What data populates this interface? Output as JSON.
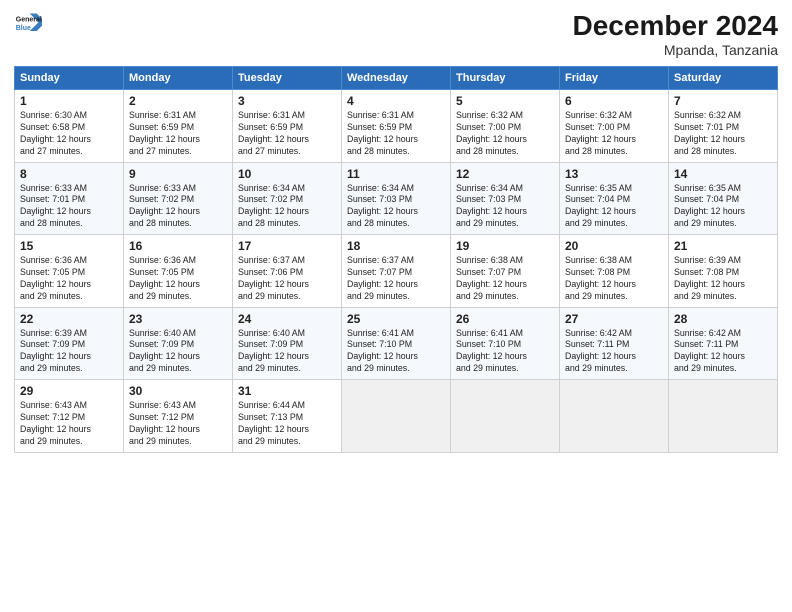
{
  "header": {
    "logo_line1": "General",
    "logo_line2": "Blue",
    "month": "December 2024",
    "location": "Mpanda, Tanzania"
  },
  "weekdays": [
    "Sunday",
    "Monday",
    "Tuesday",
    "Wednesday",
    "Thursday",
    "Friday",
    "Saturday"
  ],
  "weeks": [
    [
      {
        "day": "1",
        "info": "Sunrise: 6:30 AM\nSunset: 6:58 PM\nDaylight: 12 hours\nand 27 minutes."
      },
      {
        "day": "2",
        "info": "Sunrise: 6:31 AM\nSunset: 6:59 PM\nDaylight: 12 hours\nand 27 minutes."
      },
      {
        "day": "3",
        "info": "Sunrise: 6:31 AM\nSunset: 6:59 PM\nDaylight: 12 hours\nand 27 minutes."
      },
      {
        "day": "4",
        "info": "Sunrise: 6:31 AM\nSunset: 6:59 PM\nDaylight: 12 hours\nand 28 minutes."
      },
      {
        "day": "5",
        "info": "Sunrise: 6:32 AM\nSunset: 7:00 PM\nDaylight: 12 hours\nand 28 minutes."
      },
      {
        "day": "6",
        "info": "Sunrise: 6:32 AM\nSunset: 7:00 PM\nDaylight: 12 hours\nand 28 minutes."
      },
      {
        "day": "7",
        "info": "Sunrise: 6:32 AM\nSunset: 7:01 PM\nDaylight: 12 hours\nand 28 minutes."
      }
    ],
    [
      {
        "day": "8",
        "info": "Sunrise: 6:33 AM\nSunset: 7:01 PM\nDaylight: 12 hours\nand 28 minutes."
      },
      {
        "day": "9",
        "info": "Sunrise: 6:33 AM\nSunset: 7:02 PM\nDaylight: 12 hours\nand 28 minutes."
      },
      {
        "day": "10",
        "info": "Sunrise: 6:34 AM\nSunset: 7:02 PM\nDaylight: 12 hours\nand 28 minutes."
      },
      {
        "day": "11",
        "info": "Sunrise: 6:34 AM\nSunset: 7:03 PM\nDaylight: 12 hours\nand 28 minutes."
      },
      {
        "day": "12",
        "info": "Sunrise: 6:34 AM\nSunset: 7:03 PM\nDaylight: 12 hours\nand 29 minutes."
      },
      {
        "day": "13",
        "info": "Sunrise: 6:35 AM\nSunset: 7:04 PM\nDaylight: 12 hours\nand 29 minutes."
      },
      {
        "day": "14",
        "info": "Sunrise: 6:35 AM\nSunset: 7:04 PM\nDaylight: 12 hours\nand 29 minutes."
      }
    ],
    [
      {
        "day": "15",
        "info": "Sunrise: 6:36 AM\nSunset: 7:05 PM\nDaylight: 12 hours\nand 29 minutes."
      },
      {
        "day": "16",
        "info": "Sunrise: 6:36 AM\nSunset: 7:05 PM\nDaylight: 12 hours\nand 29 minutes."
      },
      {
        "day": "17",
        "info": "Sunrise: 6:37 AM\nSunset: 7:06 PM\nDaylight: 12 hours\nand 29 minutes."
      },
      {
        "day": "18",
        "info": "Sunrise: 6:37 AM\nSunset: 7:07 PM\nDaylight: 12 hours\nand 29 minutes."
      },
      {
        "day": "19",
        "info": "Sunrise: 6:38 AM\nSunset: 7:07 PM\nDaylight: 12 hours\nand 29 minutes."
      },
      {
        "day": "20",
        "info": "Sunrise: 6:38 AM\nSunset: 7:08 PM\nDaylight: 12 hours\nand 29 minutes."
      },
      {
        "day": "21",
        "info": "Sunrise: 6:39 AM\nSunset: 7:08 PM\nDaylight: 12 hours\nand 29 minutes."
      }
    ],
    [
      {
        "day": "22",
        "info": "Sunrise: 6:39 AM\nSunset: 7:09 PM\nDaylight: 12 hours\nand 29 minutes."
      },
      {
        "day": "23",
        "info": "Sunrise: 6:40 AM\nSunset: 7:09 PM\nDaylight: 12 hours\nand 29 minutes."
      },
      {
        "day": "24",
        "info": "Sunrise: 6:40 AM\nSunset: 7:09 PM\nDaylight: 12 hours\nand 29 minutes."
      },
      {
        "day": "25",
        "info": "Sunrise: 6:41 AM\nSunset: 7:10 PM\nDaylight: 12 hours\nand 29 minutes."
      },
      {
        "day": "26",
        "info": "Sunrise: 6:41 AM\nSunset: 7:10 PM\nDaylight: 12 hours\nand 29 minutes."
      },
      {
        "day": "27",
        "info": "Sunrise: 6:42 AM\nSunset: 7:11 PM\nDaylight: 12 hours\nand 29 minutes."
      },
      {
        "day": "28",
        "info": "Sunrise: 6:42 AM\nSunset: 7:11 PM\nDaylight: 12 hours\nand 29 minutes."
      }
    ],
    [
      {
        "day": "29",
        "info": "Sunrise: 6:43 AM\nSunset: 7:12 PM\nDaylight: 12 hours\nand 29 minutes."
      },
      {
        "day": "30",
        "info": "Sunrise: 6:43 AM\nSunset: 7:12 PM\nDaylight: 12 hours\nand 29 minutes."
      },
      {
        "day": "31",
        "info": "Sunrise: 6:44 AM\nSunset: 7:13 PM\nDaylight: 12 hours\nand 29 minutes."
      },
      {
        "day": "",
        "info": ""
      },
      {
        "day": "",
        "info": ""
      },
      {
        "day": "",
        "info": ""
      },
      {
        "day": "",
        "info": ""
      }
    ]
  ]
}
